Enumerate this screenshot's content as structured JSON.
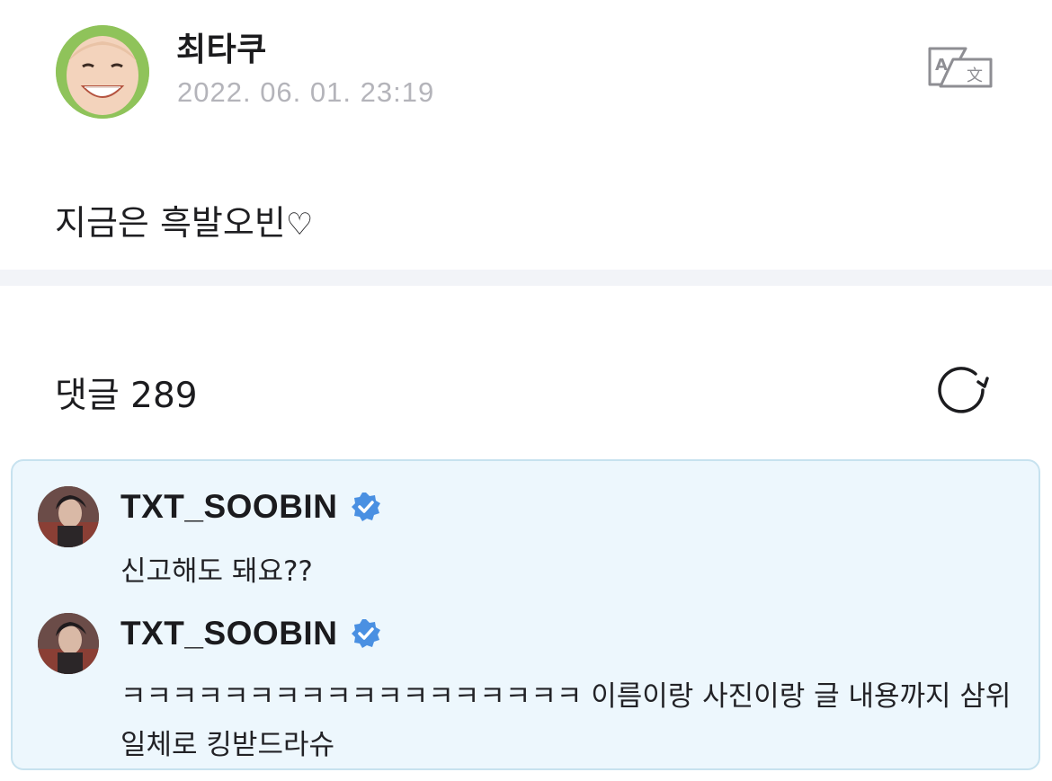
{
  "post": {
    "author": "최타쿠",
    "date": "2022. 06. 01. 23:19",
    "body": "지금은 흑발오빈",
    "body_suffix": "♡"
  },
  "comments_header": {
    "label": "댓글 289"
  },
  "comments": [
    {
      "author": "TXT_SOOBIN",
      "verified": true,
      "text": "신고해도 돼요??"
    },
    {
      "author": "TXT_SOOBIN",
      "verified": true,
      "text": "ㅋㅋㅋㅋㅋㅋㅋㅋㅋㅋㅋㅋㅋㅋㅋㅋㅋㅋ 이름이랑 사진이랑 글 내용까지 삼위일체로 킹받드라슈"
    }
  ],
  "colors": {
    "comment_highlight_bg": "#edf7fd",
    "comment_highlight_border": "#c7e2ef",
    "verified_badge": "#4a90e2",
    "date_gray": "#b4b4ba",
    "divider": "#f2f4f8"
  },
  "icons": {
    "translate": "translate-icon",
    "refresh": "refresh-icon",
    "verified": "verified-badge-icon"
  }
}
